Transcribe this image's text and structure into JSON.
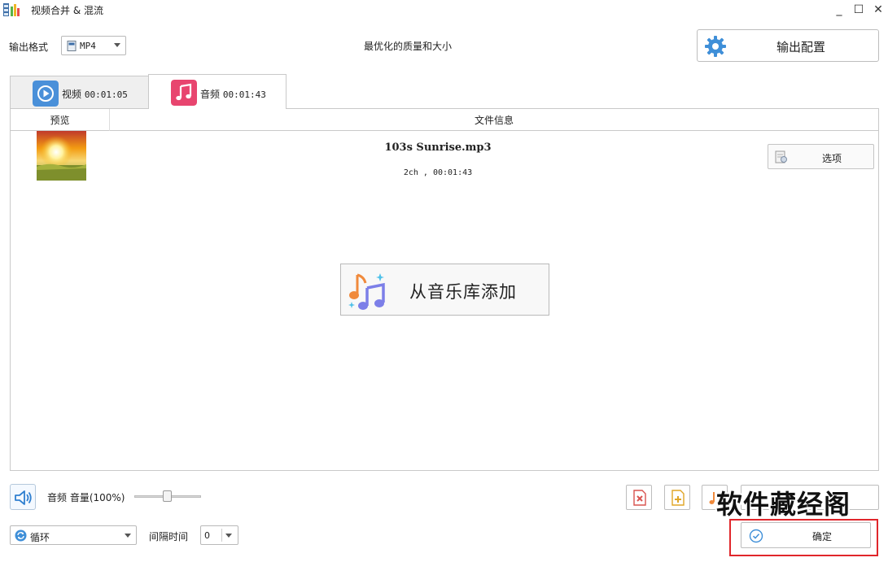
{
  "window": {
    "title": "视频合并 & 混流",
    "minimize_symbol": "_",
    "maximize_symbol": "☐",
    "close_symbol": "✕"
  },
  "header": {
    "output_format_label": "输出格式",
    "format_value": "MP4",
    "quality_text": "最优化的质量和大小",
    "output_config_label": "输出配置"
  },
  "tabs": [
    {
      "label": "视频",
      "duration": "00:01:05",
      "icon": "play-circle-icon",
      "selected": false
    },
    {
      "label": "音频",
      "duration": "00:01:43",
      "icon": "music-note-icon",
      "selected": true
    }
  ],
  "table": {
    "columns": [
      "预览",
      "文件信息"
    ],
    "rows": [
      {
        "file_name": "103s Sunrise.mp3",
        "meta": "2ch , 00:01:43",
        "options_label": "选项"
      }
    ]
  },
  "library_button_label": "从音乐库添加",
  "controls": {
    "volume_label": "音频 音量(100%)",
    "volume_percent": 100,
    "loop_value": "循环",
    "interval_label": "间隔时间",
    "interval_value": "0",
    "confirm_label": "确定"
  },
  "watermark": "软件藏经阁",
  "colors": {
    "accent_blue": "#4a90d9",
    "audio_tab_pink": "#e8456f",
    "highlight_red": "#e0262b",
    "delete_red": "#d9534f",
    "folder_yellow": "#e0a526"
  }
}
